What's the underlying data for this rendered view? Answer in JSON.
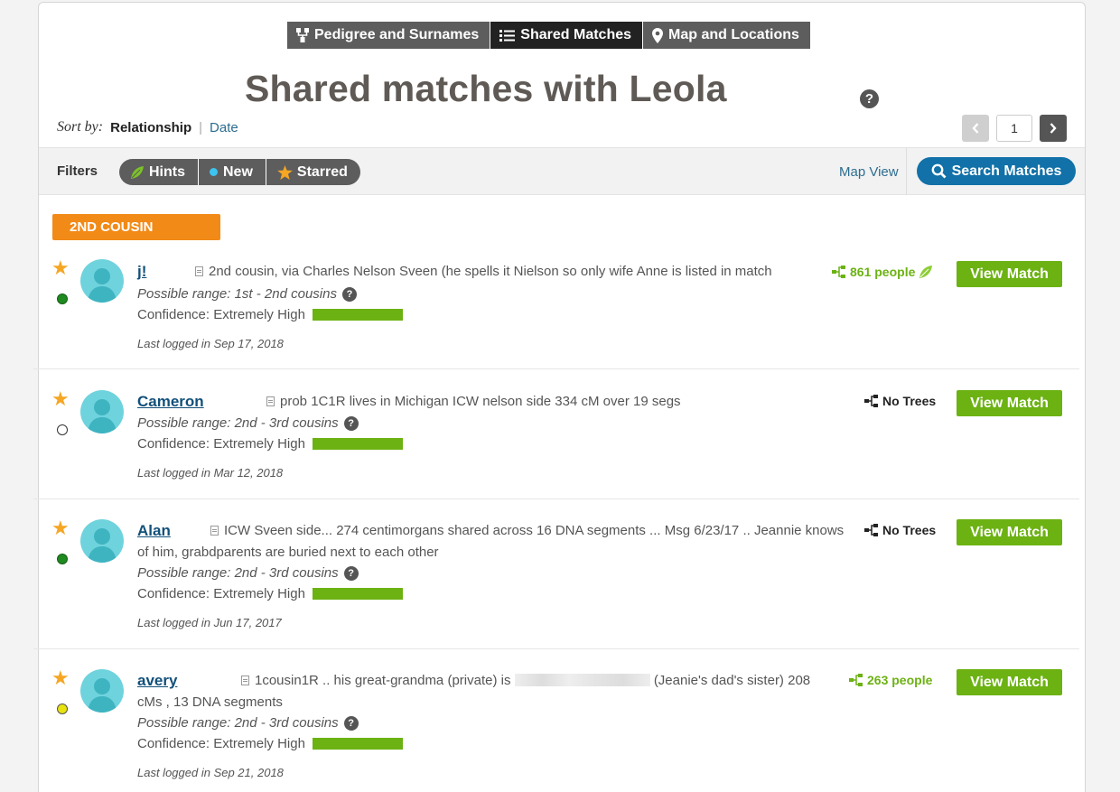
{
  "tabs": [
    {
      "label": "Pedigree and Surnames",
      "icon": "pedigree-icon"
    },
    {
      "label": "Shared Matches",
      "icon": "list-icon",
      "active": true
    },
    {
      "label": "Map and Locations",
      "icon": "map-pin-icon"
    }
  ],
  "page_title": "Shared matches with Leola",
  "help_glyph": "?",
  "sort": {
    "label": "Sort by:",
    "current": "Relationship",
    "separator": "|",
    "alternate": "Date"
  },
  "pager": {
    "page": "1"
  },
  "filters": {
    "label": "Filters",
    "pills": [
      {
        "label": "Hints",
        "icon": "leaf-icon"
      },
      {
        "label": "New",
        "icon": "dot-icon"
      },
      {
        "label": "Starred",
        "icon": "star-icon"
      }
    ],
    "map_view": "Map View",
    "search_label": "Search Matches"
  },
  "group_label": "2ND COUSIN",
  "matches": [
    {
      "name": "j!",
      "note": "2nd cousin, via Charles Nelson Sveen (he spells it Nielson so only wife Anne is listed in match",
      "range": "Possible range: 1st - 2nd cousins",
      "confidence": "Confidence: Extremely High",
      "logged": "Last logged in Sep 17, 2018",
      "tree": "861 people",
      "tree_style": "green",
      "status_color": "#1f8a1f",
      "button": "View Match"
    },
    {
      "name": "Cameron",
      "note": "prob 1C1R lives in Michigan ICW nelson side 334 cM over 19 segs",
      "range": "Possible range: 2nd - 3rd cousins",
      "confidence": "Confidence: Extremely High",
      "logged": "Last logged in Mar 12, 2018",
      "tree": "No Trees",
      "tree_style": "black",
      "status_color": "#ffffff",
      "button": "View Match"
    },
    {
      "name": "Alan",
      "note": "ICW Sveen side... 274 centimorgans shared across 16 DNA segments ... Msg 6/23/17 .. Jeannie knows",
      "note_line2": "of him, grabdparents are buried next to each other",
      "range": "Possible range: 2nd - 3rd cousins",
      "confidence": "Confidence: Extremely High",
      "logged": "Last logged in Jun 17, 2017",
      "tree": "No Trees",
      "tree_style": "black",
      "status_color": "#1f8a1f",
      "button": "View Match"
    },
    {
      "name": "avery",
      "note": "1cousin1R .. his great-grandma (private) is",
      "note_after": "(Jeanie's dad's sister) 208",
      "note_line2": "cMs , 13 DNA segments",
      "range": "Possible range: 2nd - 3rd cousins",
      "confidence": "Confidence: Extremely High",
      "logged": "Last logged in Sep 21, 2018",
      "tree": "263 people",
      "tree_style": "green",
      "status_color": "#e8e20f",
      "button": "View Match"
    }
  ],
  "colors": {
    "accent_green": "#6cb213",
    "badge_orange": "#f28a17",
    "link_blue": "#12507a",
    "search_blue": "#1171a8"
  }
}
